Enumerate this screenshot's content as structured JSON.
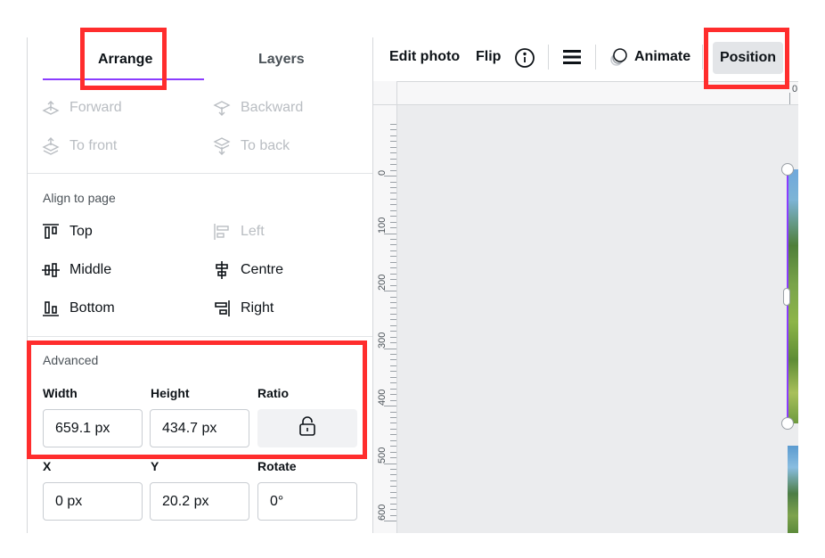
{
  "tabs": {
    "arrange": "Arrange",
    "layers": "Layers"
  },
  "layer_order": [
    {
      "label": "Forward",
      "icon": "forward-icon"
    },
    {
      "label": "Backward",
      "icon": "backward-icon"
    },
    {
      "label": "To front",
      "icon": "to-front-icon"
    },
    {
      "label": "To back",
      "icon": "to-back-icon"
    }
  ],
  "align": {
    "title": "Align to page",
    "items": [
      {
        "label": "Top",
        "icon": "align-top-icon",
        "enabled": true
      },
      {
        "label": "Left",
        "icon": "align-left-icon",
        "enabled": false
      },
      {
        "label": "Middle",
        "icon": "align-middle-icon",
        "enabled": true
      },
      {
        "label": "Centre",
        "icon": "align-centre-icon",
        "enabled": true
      },
      {
        "label": "Bottom",
        "icon": "align-bottom-icon",
        "enabled": true
      },
      {
        "label": "Right",
        "icon": "align-right-icon",
        "enabled": true
      }
    ]
  },
  "advanced": {
    "title": "Advanced",
    "width_label": "Width",
    "width_value": "659.1 px",
    "height_label": "Height",
    "height_value": "434.7 px",
    "ratio_label": "Ratio",
    "ratio_icon": "unlocked-padlock-icon",
    "x_label": "X",
    "x_value": "0 px",
    "y_label": "Y",
    "y_value": "20.2 px",
    "rotate_label": "Rotate",
    "rotate_value": "0°"
  },
  "toolbar": {
    "edit_photo": "Edit photo",
    "flip": "Flip",
    "info_icon": "info-icon",
    "menu_icon": "hamburger-icon",
    "animate": "Animate",
    "animate_icon": "animate-icon",
    "position": "Position"
  },
  "rulers": {
    "top": [
      "0"
    ],
    "left": [
      "0",
      "100",
      "200",
      "300",
      "400",
      "500",
      "600"
    ]
  },
  "colors": {
    "accent": "#8b3dff",
    "highlight": "#ff2d2d",
    "disabled_text": "#b9bdc2"
  }
}
